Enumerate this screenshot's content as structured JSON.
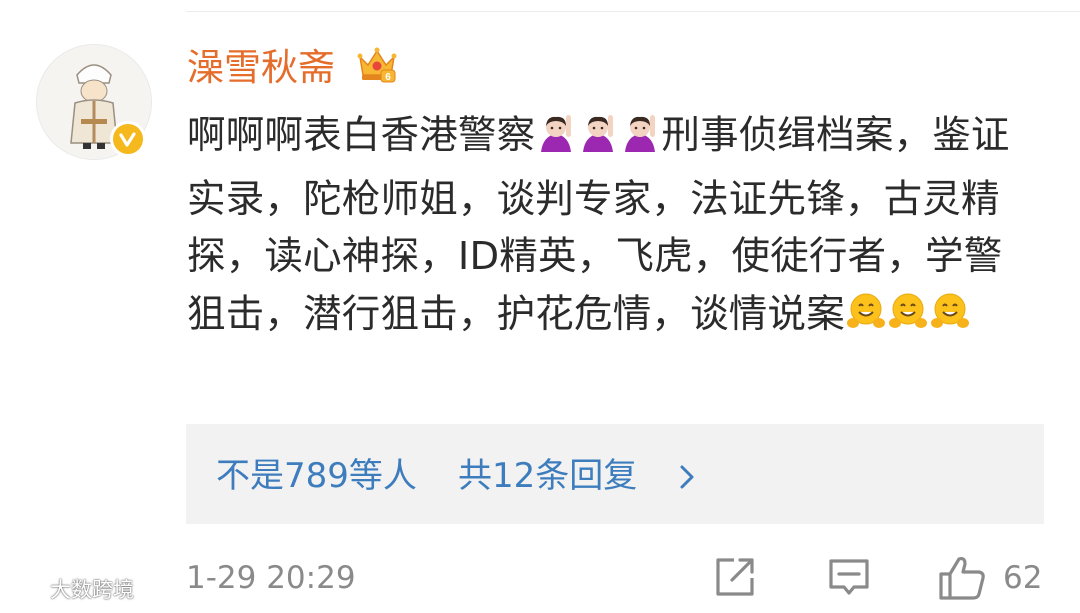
{
  "comment": {
    "username": "澡雪秋斋",
    "text_part1": "啊啊啊表白香港警察",
    "text_part2": "刑事侦缉档案，鉴证实录，陀枪师姐，谈判专家，法证先锋，古灵精探，读心神探，ID精英，飞虎，使徒行者，学警狙击，潜行狙击，护花危情，谈情说案",
    "inline_emoji_1": "person-raising-hand-emoji",
    "inline_emoji_2": "hugging-face-emoji",
    "timestamp": "1-29 20:29",
    "like_count": "62"
  },
  "replies": {
    "likers": "不是789等人",
    "link": "共12条回复"
  },
  "icons": {
    "verified": "verified-badge-icon",
    "vip": "crown-vip-icon",
    "share": "share-icon",
    "comment": "comment-icon",
    "like": "thumbs-up-icon"
  },
  "watermark": "大数跨境",
  "colors": {
    "username": "#e56d2b",
    "link": "#3e7dbd",
    "text": "#2b2b2b",
    "meta": "#8a8a8a",
    "verified": "#f5b81d",
    "reply_bg": "#f2f2f2"
  }
}
